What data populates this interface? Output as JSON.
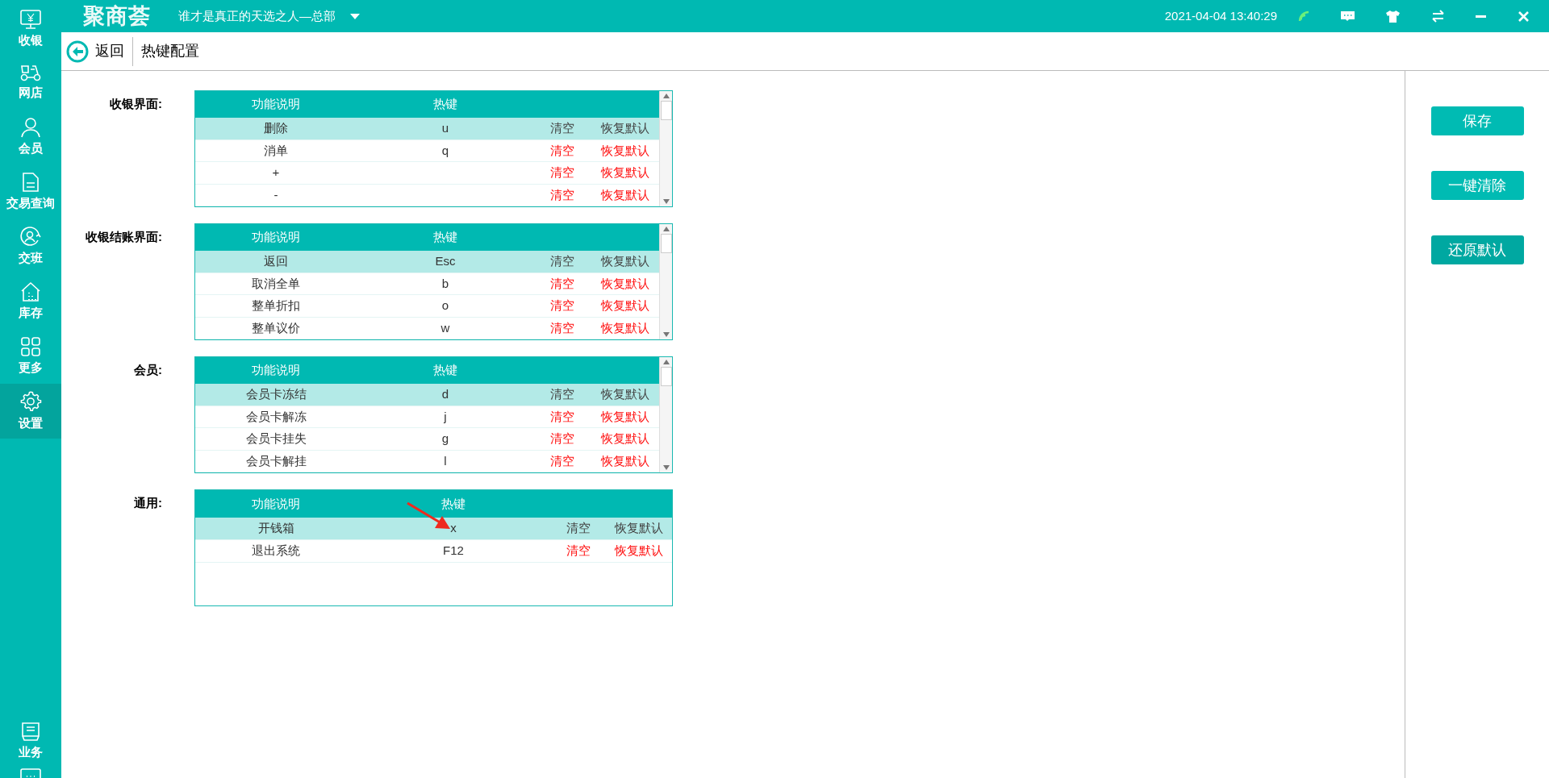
{
  "sidebar": {
    "items": [
      {
        "label": "收银",
        "selected": false
      },
      {
        "label": "网店",
        "selected": false
      },
      {
        "label": "会员",
        "selected": false
      },
      {
        "label": "交易查询",
        "selected": false
      },
      {
        "label": "交班",
        "selected": false
      },
      {
        "label": "库存",
        "selected": false
      },
      {
        "label": "更多",
        "selected": false
      },
      {
        "label": "设置",
        "selected": true
      }
    ],
    "bottom_items": [
      {
        "label": "业务"
      }
    ]
  },
  "title_bar": {
    "logo": "聚商荟",
    "store": "谁才是真正的天选之人—总部",
    "datetime": "2021-04-04 13:40:29"
  },
  "header": {
    "back": "返回",
    "title": "热键配置"
  },
  "sections": [
    {
      "label": "收银界面:",
      "scrollable": true,
      "columns": [
        "功能说明",
        "热键"
      ],
      "rows": [
        {
          "name": "删除",
          "key": "u",
          "clear": "清空",
          "restore": "恢复默认",
          "selected": true
        },
        {
          "name": "消单",
          "key": "q",
          "clear": "清空",
          "restore": "恢复默认",
          "selected": false
        },
        {
          "name": "+",
          "key": "",
          "clear": "清空",
          "restore": "恢复默认",
          "selected": false
        },
        {
          "name": "-",
          "key": "",
          "clear": "清空",
          "restore": "恢复默认",
          "selected": false
        }
      ]
    },
    {
      "label": "收银结账界面:",
      "scrollable": true,
      "columns": [
        "功能说明",
        "热键"
      ],
      "rows": [
        {
          "name": "返回",
          "key": "Esc",
          "clear": "清空",
          "restore": "恢复默认",
          "selected": true
        },
        {
          "name": "取消全单",
          "key": "b",
          "clear": "清空",
          "restore": "恢复默认",
          "selected": false
        },
        {
          "name": "整单折扣",
          "key": "o",
          "clear": "清空",
          "restore": "恢复默认",
          "selected": false
        },
        {
          "name": "整单议价",
          "key": "w",
          "clear": "清空",
          "restore": "恢复默认",
          "selected": false
        }
      ]
    },
    {
      "label": "会员:",
      "scrollable": true,
      "columns": [
        "功能说明",
        "热键"
      ],
      "rows": [
        {
          "name": "会员卡冻结",
          "key": "d",
          "clear": "清空",
          "restore": "恢复默认",
          "selected": true
        },
        {
          "name": "会员卡解冻",
          "key": "j",
          "clear": "清空",
          "restore": "恢复默认",
          "selected": false
        },
        {
          "name": "会员卡挂失",
          "key": "g",
          "clear": "清空",
          "restore": "恢复默认",
          "selected": false
        },
        {
          "name": "会员卡解挂",
          "key": "l",
          "clear": "清空",
          "restore": "恢复默认",
          "selected": false
        }
      ]
    },
    {
      "label": "通用:",
      "scrollable": false,
      "columns": [
        "功能说明",
        "热键"
      ],
      "rows": [
        {
          "name": "开钱箱",
          "key": "x",
          "clear": "清空",
          "restore": "恢复默认",
          "selected": true,
          "marked": true
        },
        {
          "name": "退出系统",
          "key": "F12",
          "clear": "清空",
          "restore": "恢复默认",
          "selected": false,
          "marked": false
        }
      ]
    }
  ],
  "actions": [
    {
      "label": "保存",
      "kind": "primary"
    },
    {
      "label": "一键清除",
      "kind": "primary"
    },
    {
      "label": "还原默认",
      "kind": "dark"
    }
  ]
}
